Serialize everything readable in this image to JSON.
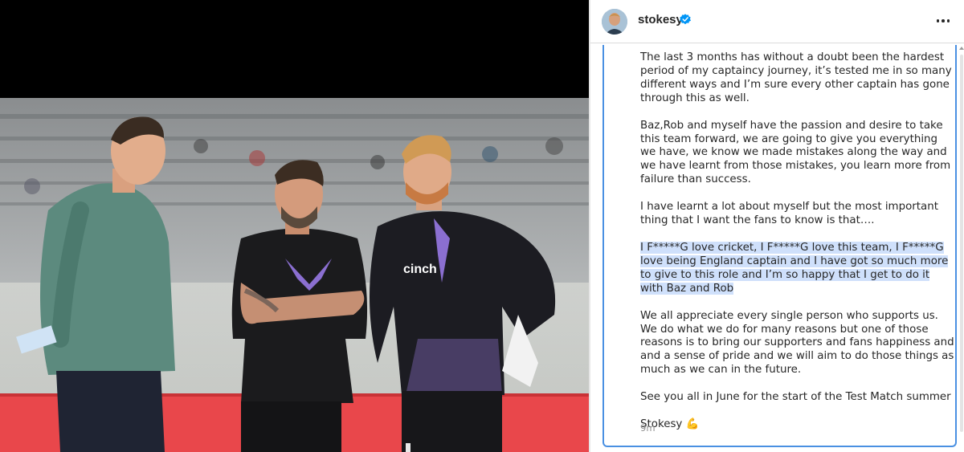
{
  "post": {
    "username": "stokesy",
    "verified": true,
    "more_label": "More options",
    "caption": {
      "para1": "The last 3 months has without a doubt been the hardest period of my captaincy journey, it’s tested me in so many different ways and I’m sure every other captain has gone through this as well.",
      "para2": "Baz,Rob and myself have the passion and desire to take this team forward, we are going to give you everything we have, we know we made mistakes along the way and we have learnt from those mistakes, you learn more from failure than success.",
      "para3": "I have learnt a lot about myself but the most important thing that I want the fans to know is that….",
      "para4_highlighted": "I F*****G love cricket, I F*****G love this team, I F*****G love being England captain and I have got so much more to give to this role and I’m so happy that I get to do it with Baz and Rob",
      "para5": "We all appreciate every single person who supports us. We do what we do for many reasons but one of those reasons is to bring our supporters and fans happiness and and a sense of pride and we will aim to do those things as much as we can in the future.",
      "para6": "See you all in June for the start of the Test Match summer",
      "signoff": "Stokesy 💪"
    },
    "timestamp": "9m"
  },
  "photo": {
    "shirt_logo_text": "cinch"
  },
  "colors": {
    "verified_blue": "#0095f6",
    "highlight": "#cfe0fb",
    "focus_border": "#4a90e2",
    "text": "#262626",
    "muted": "#8e8e8e"
  },
  "icons": [
    "verified-badge-icon",
    "more-options-icon"
  ]
}
